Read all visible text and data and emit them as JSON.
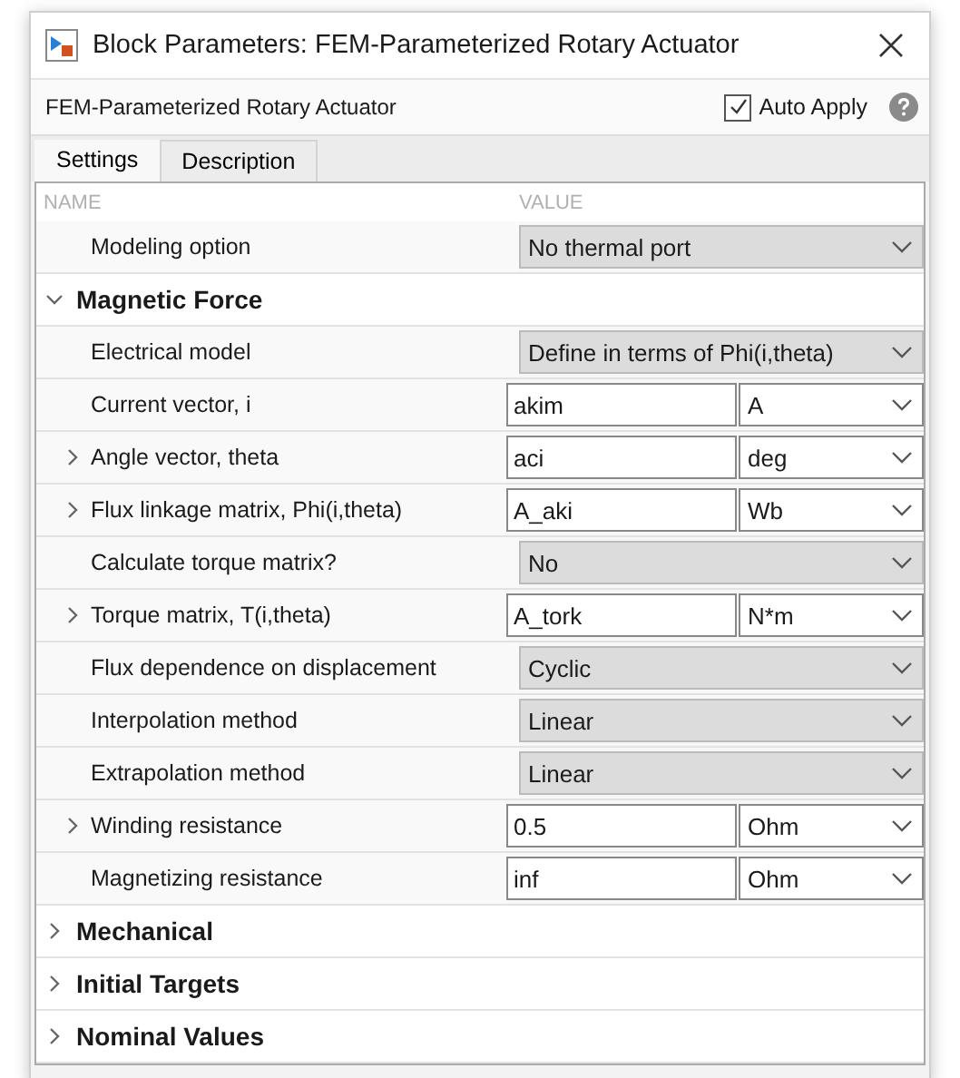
{
  "window": {
    "title": "Block Parameters: FEM-Parameterized Rotary Actuator"
  },
  "header": {
    "block_name": "FEM-Parameterized Rotary Actuator",
    "auto_apply": {
      "label": "Auto Apply",
      "checked": true
    }
  },
  "tabs": [
    {
      "label": "Settings",
      "selected": true
    },
    {
      "label": "Description",
      "selected": false
    }
  ],
  "table": {
    "columns": [
      "NAME",
      "VALUE"
    ],
    "rows": [
      {
        "kind": "dropdown",
        "name": "Modeling option",
        "value": "No thermal port"
      }
    ],
    "sections": [
      {
        "title": "Magnetic Force",
        "expanded": true,
        "rows": [
          {
            "kind": "dropdown",
            "name": "Electrical model",
            "value": "Define in terms of Phi(i,theta)"
          },
          {
            "kind": "field_unit",
            "name": "Current vector, i",
            "value": "akim",
            "unit": "A"
          },
          {
            "kind": "field_unit",
            "name": "Angle vector, theta",
            "value": "aci",
            "unit": "deg",
            "expanded": false
          },
          {
            "kind": "field_unit",
            "name": "Flux linkage matrix, Phi(i,theta)",
            "value": "A_aki",
            "unit": "Wb",
            "expanded": false
          },
          {
            "kind": "dropdown",
            "name": "Calculate torque matrix?",
            "value": "No"
          },
          {
            "kind": "field_unit",
            "name": "Torque matrix, T(i,theta)",
            "value": "A_tork",
            "unit": "N*m",
            "expanded": false
          },
          {
            "kind": "dropdown",
            "name": "Flux dependence on displacement",
            "value": "Cyclic"
          },
          {
            "kind": "dropdown",
            "name": "Interpolation method",
            "value": "Linear"
          },
          {
            "kind": "dropdown",
            "name": "Extrapolation method",
            "value": "Linear"
          },
          {
            "kind": "field_unit",
            "name": "Winding resistance",
            "value": "0.5",
            "unit": "Ohm",
            "expanded": false
          },
          {
            "kind": "field_unit",
            "name": "Magnetizing resistance",
            "value": "inf",
            "unit": "Ohm"
          }
        ]
      },
      {
        "title": "Mechanical",
        "expanded": false
      },
      {
        "title": "Initial Targets",
        "expanded": false
      },
      {
        "title": "Nominal Values",
        "expanded": false
      }
    ]
  }
}
